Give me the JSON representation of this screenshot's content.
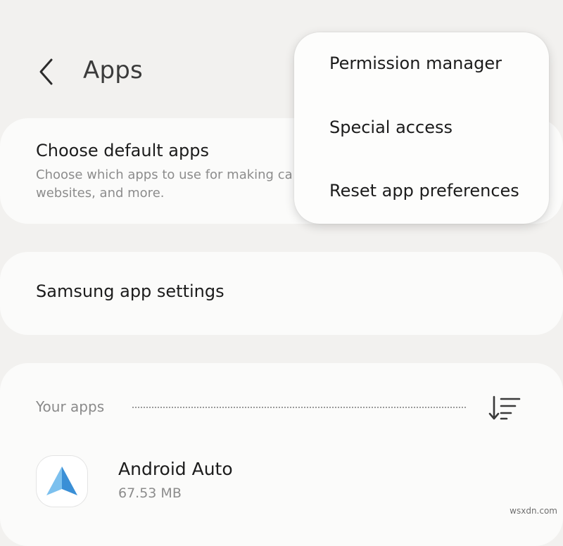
{
  "header": {
    "title": "Apps",
    "back_icon": "chevron-left-icon"
  },
  "default_apps": {
    "title": "Choose default apps",
    "subtitle_line1": "Choose which apps to use for making ca",
    "subtitle_line2": "websites, and more."
  },
  "samsung_settings": {
    "title": "Samsung app settings"
  },
  "your_apps": {
    "section_label": "Your apps",
    "sort_icon": "sort-icon",
    "apps": [
      {
        "name": "Android Auto",
        "size": "67.53 MB",
        "icon": "android-auto-icon"
      }
    ]
  },
  "overflow_menu": {
    "items": [
      {
        "label": "Permission manager"
      },
      {
        "label": "Special access"
      },
      {
        "label": "Reset app preferences"
      }
    ]
  },
  "watermark": "wsxdn.com",
  "colors": {
    "background": "#f2f1ef",
    "card": "#fbfbfa",
    "android_auto_blue": "#3a8fd6",
    "android_auto_light": "#7cc0ee"
  }
}
